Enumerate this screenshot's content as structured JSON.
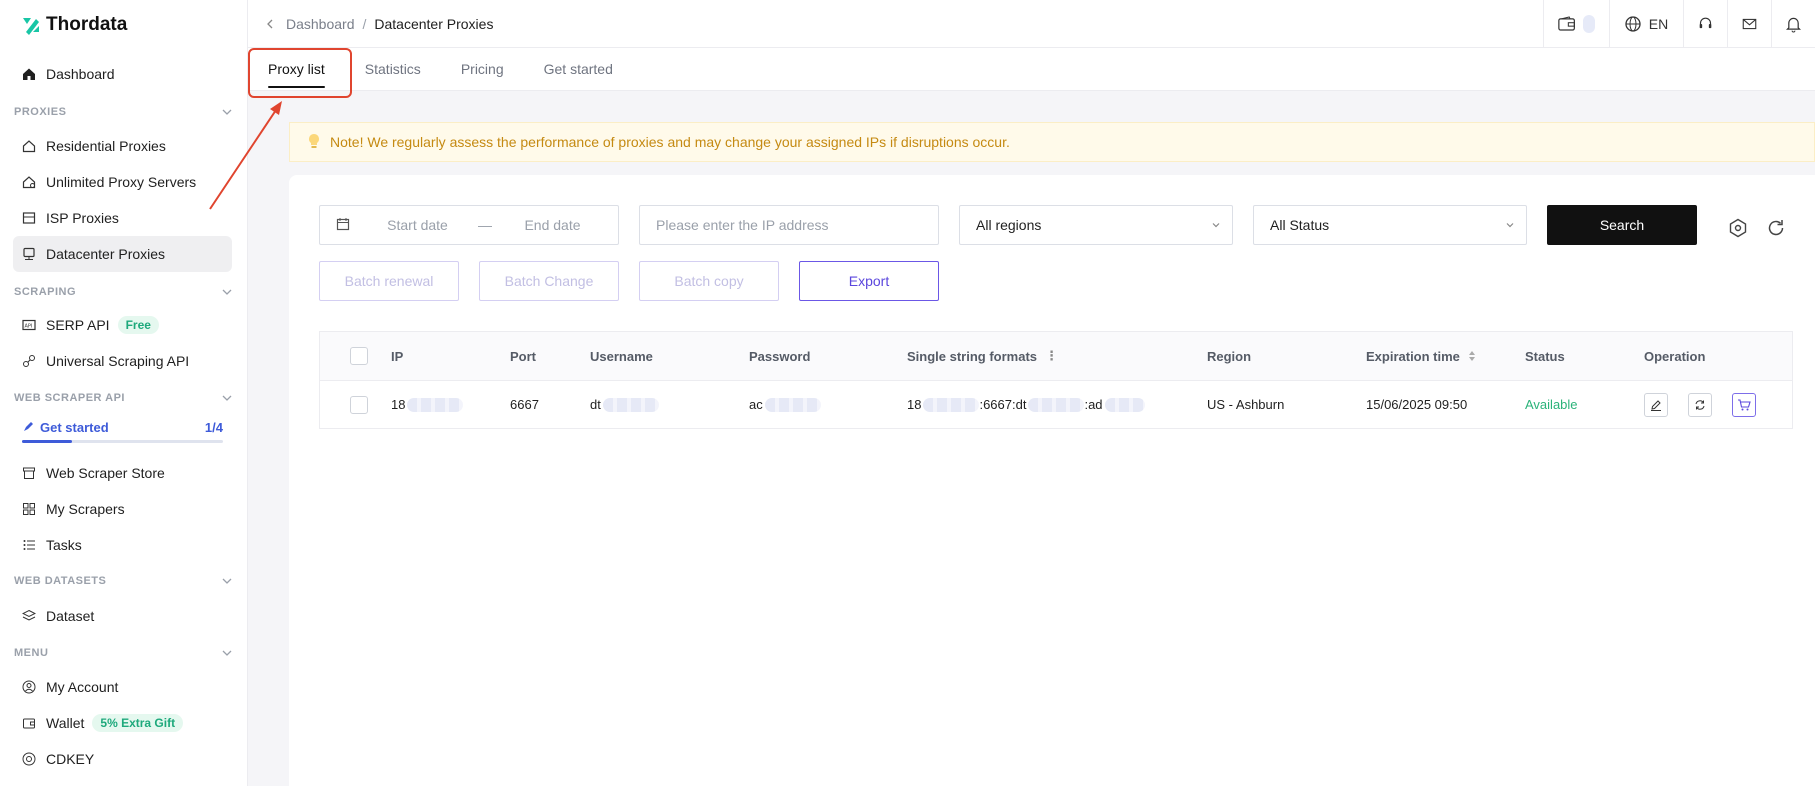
{
  "app": {
    "name": "Thordata"
  },
  "sidebar": {
    "items": {
      "dashboard": "Dashboard",
      "residential": "Residential Proxies",
      "unlimited": "Unlimited Proxy Servers",
      "isp": "ISP Proxies",
      "datacenter": "Datacenter Proxies",
      "serp": "SERP API",
      "serp_badge": "Free",
      "universal": "Universal Scraping API",
      "get_started": "Get started",
      "get_started_progress": "1/4",
      "get_started_fraction": 0.25,
      "store": "Web Scraper Store",
      "my_scrapers": "My Scrapers",
      "tasks": "Tasks",
      "dataset": "Dataset",
      "my_account": "My Account",
      "wallet": "Wallet",
      "wallet_badge": "5% Extra Gift",
      "cdkey": "CDKEY"
    },
    "sections": {
      "proxies": "PROXIES",
      "scraping": "SCRAPING",
      "web_scraper_api": "WEB SCRAPER API",
      "web_datasets": "WEB DATASETS",
      "menu": "MENU"
    }
  },
  "header": {
    "breadcrumb_prev": "Dashboard",
    "breadcrumb_sep": "/",
    "breadcrumb_current": "Datacenter Proxies",
    "language": "EN"
  },
  "tabs": [
    "Proxy list",
    "Statistics",
    "Pricing",
    "Get started"
  ],
  "notice": "Note! We regularly assess the performance of proxies and may change your assigned IPs if disruptions occur.",
  "filters": {
    "start_placeholder": "Start date",
    "date_sep": "—",
    "end_placeholder": "End date",
    "ip_placeholder": "Please enter the IP address",
    "region": "All regions",
    "status": "All Status",
    "search": "Search"
  },
  "actions": {
    "batch_renewal": "Batch renewal",
    "batch_change": "Batch Change",
    "batch_copy": "Batch copy",
    "export": "Export"
  },
  "table": {
    "columns": [
      "IP",
      "Port",
      "Username",
      "Password",
      "Single string formats",
      "Region",
      "Expiration time",
      "Status",
      "Operation"
    ],
    "rows": [
      {
        "ip": "18",
        "port": "6667",
        "username": "dt",
        "password": "ac",
        "string_a": "18",
        "string_b": ":6667:dt",
        "string_c": ":ad",
        "region": "US - Ashburn",
        "expiration": "15/06/2025 09:50",
        "status": "Available"
      }
    ]
  },
  "colors": {
    "accent": "#5b47dd",
    "status_ok": "#2bb37a",
    "annotation": "#e0452f",
    "notice_text": "#c58a12"
  }
}
